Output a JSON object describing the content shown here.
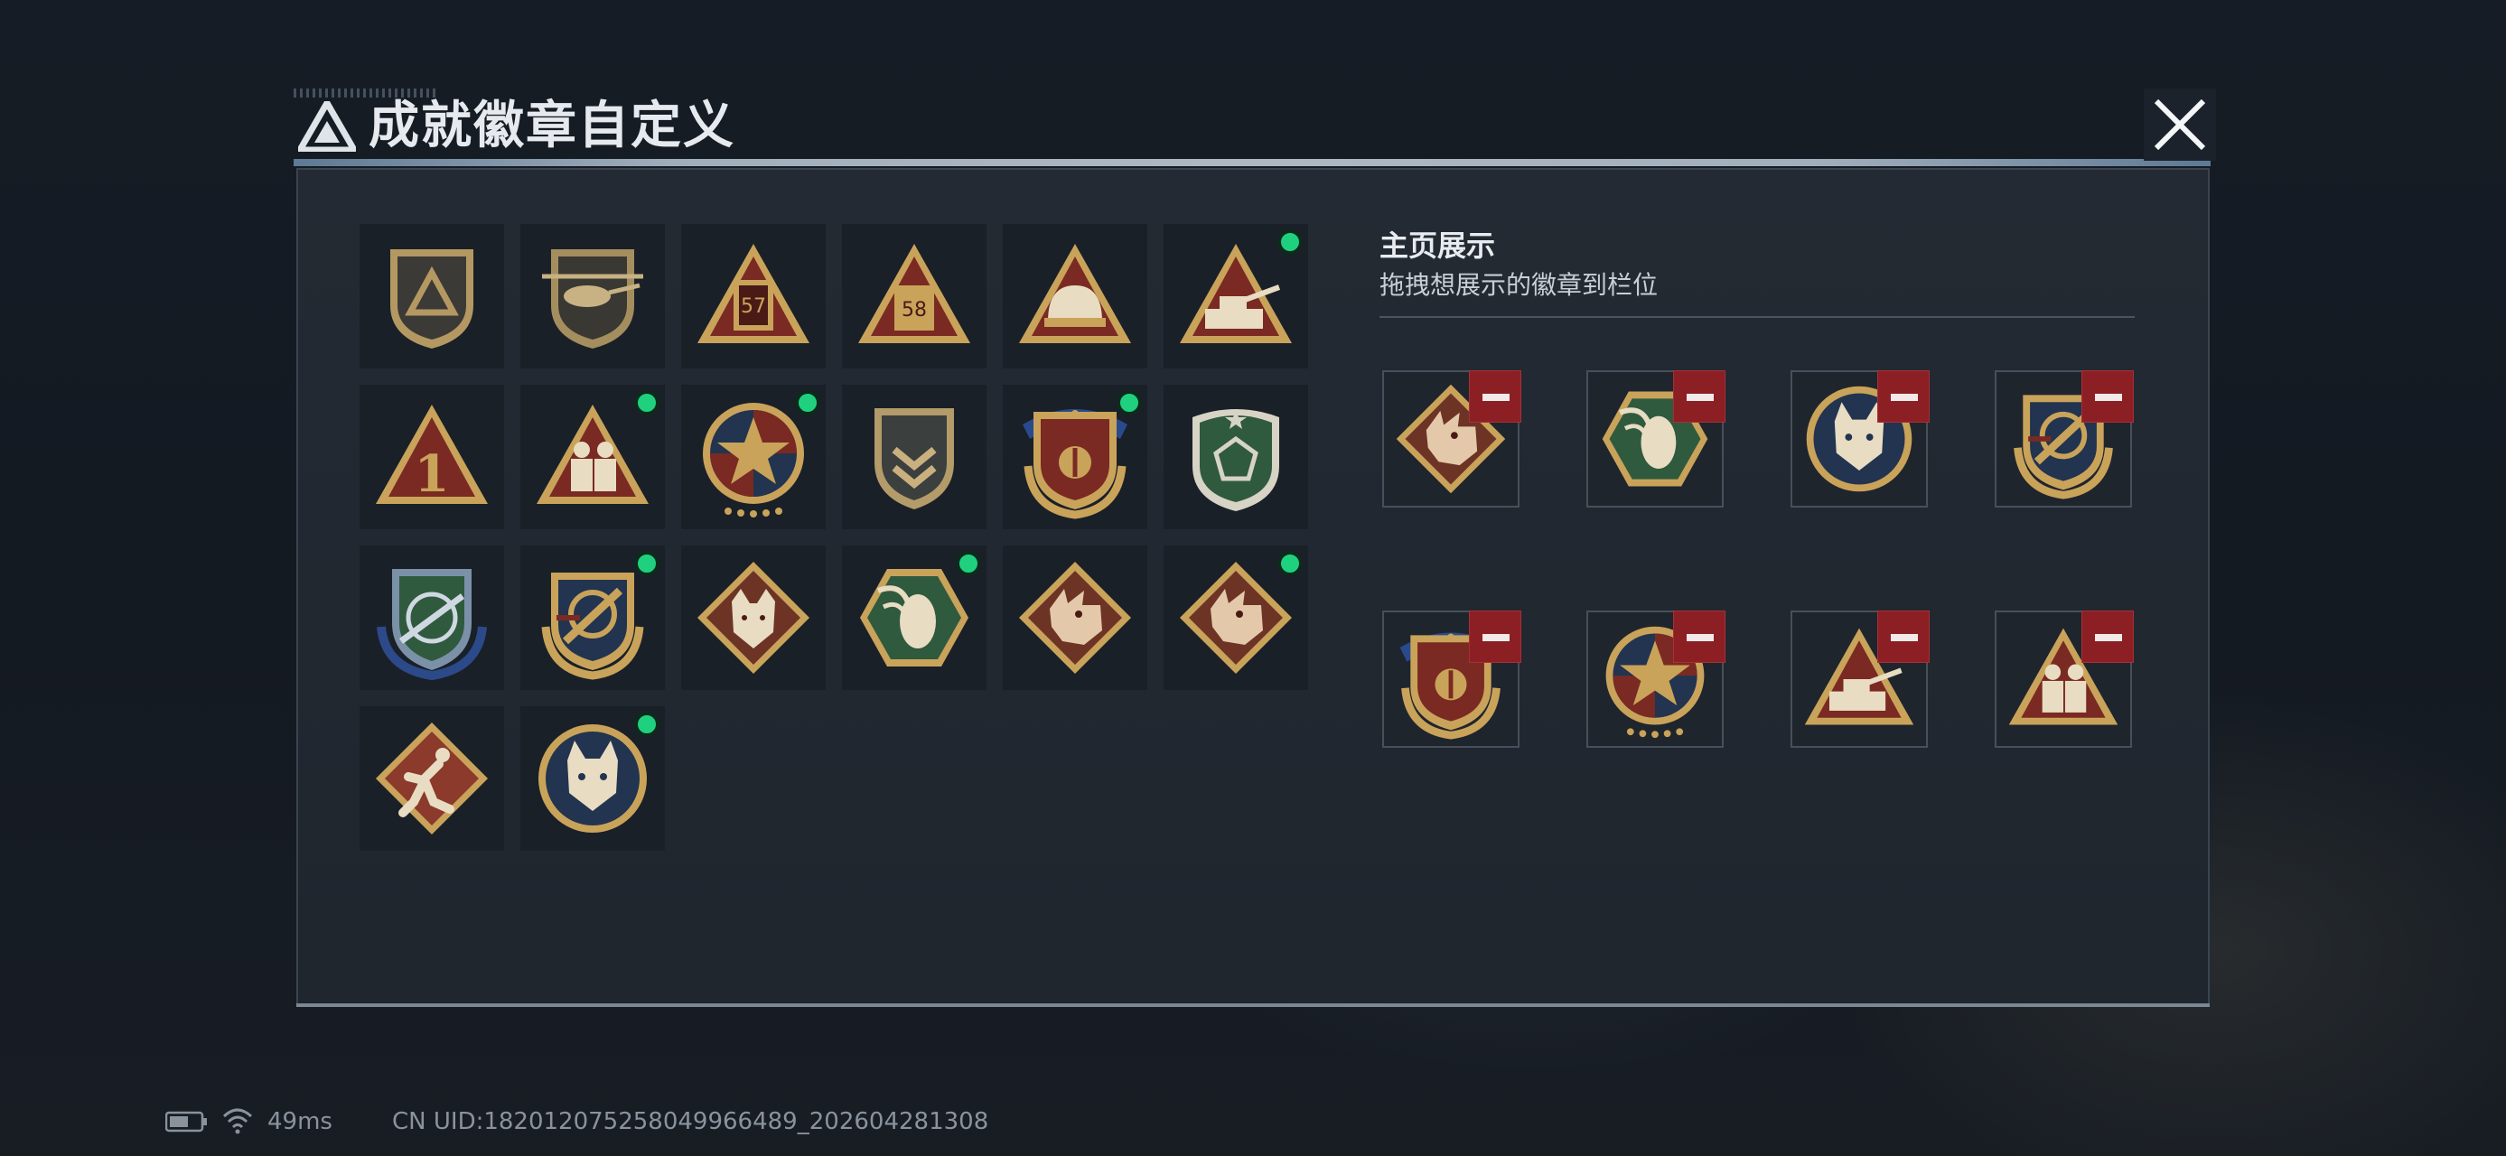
{
  "header": {
    "title": "成就徽章自定义",
    "close_icon": "close-icon",
    "logo_icon": "triangle-logo-icon"
  },
  "colors": {
    "new_dot": "#1fd17f",
    "remove_button": "#8c1f24",
    "gold": "#c9a35a",
    "crimson": "#7a2a22",
    "navy": "#22344f",
    "green": "#2f5a3e"
  },
  "badges": [
    {
      "name": "shield-triangle-badge",
      "new": false
    },
    {
      "name": "helicopter-shield-badge",
      "new": false
    },
    {
      "name": "number-57-triangle-badge",
      "new": false
    },
    {
      "name": "number-58-triangle-badge",
      "new": false
    },
    {
      "name": "helmet-triangle-badge",
      "new": false
    },
    {
      "name": "tank-triangle-badge",
      "new": true
    },
    {
      "name": "number-1-triangle-badge",
      "new": false
    },
    {
      "name": "soldiers-triangle-badge",
      "new": true
    },
    {
      "name": "star-medal-badge",
      "new": true
    },
    {
      "name": "chevron-shield-badge",
      "new": false
    },
    {
      "name": "ribbon-shield-badge",
      "new": true
    },
    {
      "name": "green-gem-shield-badge",
      "new": false
    },
    {
      "name": "sniper-shield-badge",
      "new": false
    },
    {
      "name": "rocket-laurel-shield-badge",
      "new": true
    },
    {
      "name": "wolf-diamond-badge",
      "new": false
    },
    {
      "name": "wasp-hexagon-badge",
      "new": true
    },
    {
      "name": "dragon-diamond-badge",
      "new": false
    },
    {
      "name": "dragon-diamond-badge-2",
      "new": true
    },
    {
      "name": "runner-diamond-badge",
      "new": false
    },
    {
      "name": "lynx-circle-badge",
      "new": true
    }
  ],
  "showcase": {
    "title": "主页展示",
    "subtitle": "拖拽想展示的徽章到栏位",
    "slots": [
      {
        "badge": "dragon-diamond-badge"
      },
      {
        "badge": "wasp-hexagon-badge"
      },
      {
        "badge": "lynx-circle-badge"
      },
      {
        "badge": "rocket-laurel-shield-badge"
      },
      {
        "badge": "ribbon-shield-badge"
      },
      {
        "badge": "star-medal-badge"
      },
      {
        "badge": "tank-triangle-badge"
      },
      {
        "badge": "soldiers-triangle-badge"
      }
    ]
  },
  "status": {
    "ping": "49ms",
    "uid": "CN UID:182012075258049966489_202604281308",
    "battery_icon": "battery-icon",
    "wifi_icon": "wifi-icon"
  }
}
